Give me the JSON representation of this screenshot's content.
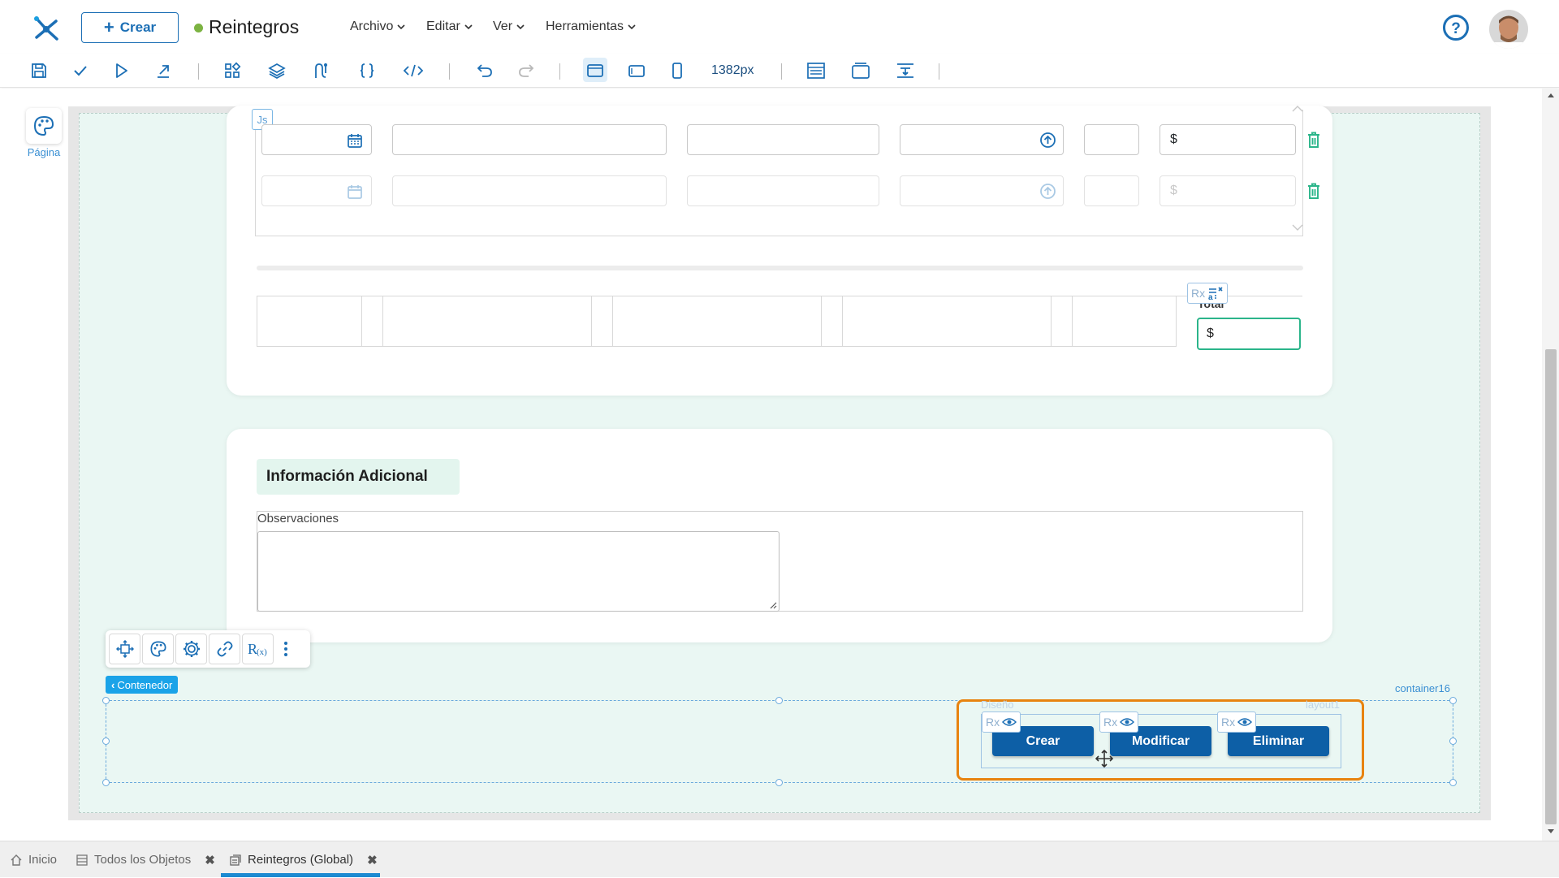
{
  "header": {
    "create_label": "Crear",
    "app_title": "Reintegros",
    "menus": [
      "Archivo",
      "Editar",
      "Ver",
      "Herramientas"
    ]
  },
  "toolbar": {
    "icons": [
      "save-icon",
      "check-icon",
      "play-icon",
      "export-icon",
      "components-icon",
      "layers-icon",
      "flow-icon",
      "braces-icon",
      "code-icon",
      "undo-icon",
      "redo-icon",
      "desktop-view-icon",
      "tablet-view-icon",
      "mobile-view-icon",
      "layout-icon",
      "window-icon",
      "align-icon"
    ],
    "width_readout": "1382px"
  },
  "sidebar": {
    "page_label": "Página"
  },
  "grid": {
    "js_badge": "Js",
    "currency_symbol": "$",
    "total_label": "Total",
    "total_value": "$",
    "rx_label": "Rx"
  },
  "additional": {
    "section_title": "Información Adicional",
    "observations_label": "Observaciones"
  },
  "selection": {
    "breadcrumb": "Contenedor",
    "container_name": "container16",
    "design_ghost": "Diseño",
    "layout_ghost": "layout1",
    "rx_label": "Rx"
  },
  "actions": {
    "create": "Crear",
    "modify": "Modificar",
    "delete": "Eliminar"
  },
  "tabs": [
    {
      "label": "Inicio"
    },
    {
      "label": "Todos los Objetos"
    },
    {
      "label": "Reintegros (Global)"
    }
  ],
  "colors": {
    "accent": "#1c6fb5",
    "action_button": "#0d5fa6",
    "selection_orange": "#e8830f",
    "teal_trash": "#2bb58a",
    "status_dot": "#7cb342"
  }
}
